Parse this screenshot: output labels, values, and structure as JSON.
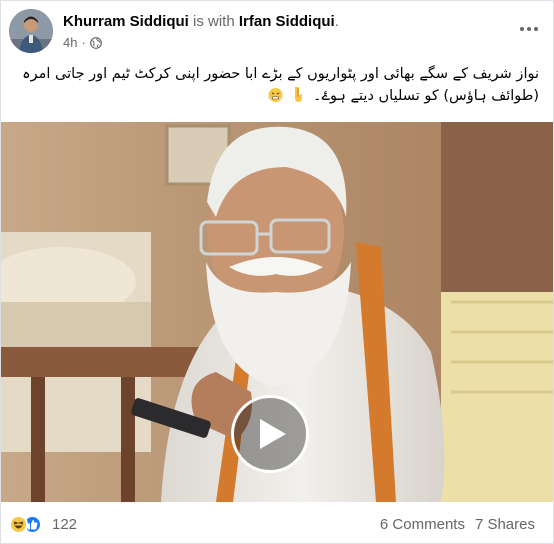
{
  "post": {
    "author": "Khurram Siddiqui",
    "with_text": "is with",
    "tagged": "Irfan Siddiqui",
    "tagged_suffix": ".",
    "time": "4h",
    "separator": "·",
    "audience_icon": "globe-icon",
    "text": "نواز شریف کے سگے بھائی اور پٹواریوں کے بڑے ابا حضور  اپنی کرکٹ ٹیم اور جاتی امرہ (طوائف ہاؤس) کو تسلیاں دیتے ہوۓ۔",
    "emojis": [
      "backhand-index-pointing-down-icon",
      "face-with-steam-icon"
    ]
  },
  "video": {
    "play_icon": "play-icon"
  },
  "footer": {
    "reaction_icons": [
      "haha-reaction-icon",
      "like-reaction-icon"
    ],
    "reaction_count": "122",
    "comments": "6 Comments",
    "shares": "7 Shares"
  },
  "colors": {
    "secondary_text": "#65676b",
    "primary_text": "#050505",
    "like_blue": "#1877f2",
    "haha_yellow": "#f7c844"
  }
}
